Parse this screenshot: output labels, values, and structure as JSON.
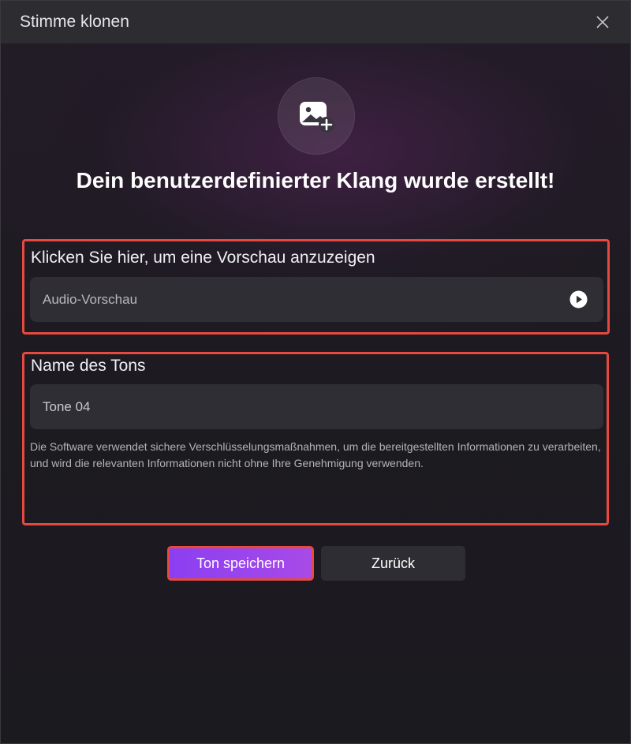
{
  "window": {
    "title": "Stimme klonen"
  },
  "hero": {
    "icon": "image-add-icon",
    "headline": "Dein benutzerdefinierter Klang wurde erstellt!"
  },
  "preview": {
    "label": "Klicken Sie hier, um eine Vorschau anzuzeigen",
    "field_text": "Audio-Vorschau",
    "icon": "play-icon"
  },
  "tone_name": {
    "label": "Name des Tons",
    "value": "Tone 04",
    "disclaimer": "Die Software verwendet sichere Verschlüsselungsmaßnahmen, um die bereitgestellten Informationen zu verarbeiten, und wird die relevanten Informationen nicht ohne Ihre Genehmigung verwenden."
  },
  "actions": {
    "save_label": "Ton speichern",
    "back_label": "Zurück"
  },
  "colors": {
    "accent": "#9a45ee",
    "highlight_border": "#e5493f",
    "field_bg": "#2f2e34"
  }
}
